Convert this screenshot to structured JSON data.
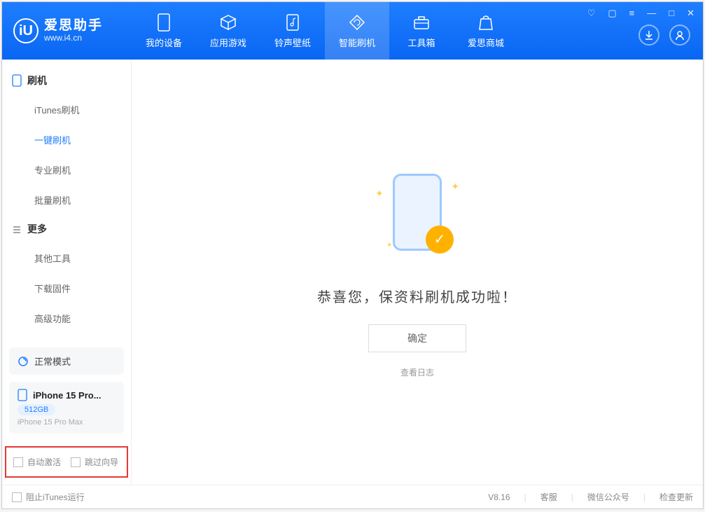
{
  "app": {
    "title": "爱思助手",
    "url": "www.i4.cn"
  },
  "nav": {
    "items": [
      {
        "label": "我的设备"
      },
      {
        "label": "应用游戏"
      },
      {
        "label": "铃声壁纸"
      },
      {
        "label": "智能刷机"
      },
      {
        "label": "工具箱"
      },
      {
        "label": "爱思商城"
      }
    ]
  },
  "sidebar": {
    "group1": {
      "title": "刷机",
      "items": [
        "iTunes刷机",
        "一键刷机",
        "专业刷机",
        "批量刷机"
      ]
    },
    "group2": {
      "title": "更多",
      "items": [
        "其他工具",
        "下载固件",
        "高级功能"
      ]
    },
    "mode": "正常模式",
    "device": {
      "name": "iPhone 15 Pro...",
      "storage": "512GB",
      "full_name": "iPhone 15 Pro Max"
    },
    "check_auto_activate": "自动激活",
    "check_skip_wizard": "跳过向导"
  },
  "main": {
    "success_text": "恭喜您，保资料刷机成功啦！",
    "ok_button": "确定",
    "view_log": "查看日志"
  },
  "footer": {
    "block_itunes": "阻止iTunes运行",
    "version": "V8.16",
    "support": "客服",
    "wechat": "微信公众号",
    "check_update": "检查更新"
  }
}
